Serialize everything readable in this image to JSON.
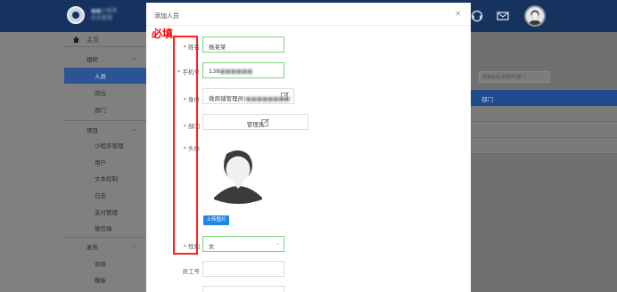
{
  "app": {
    "brand_line1": "■■小程序",
    "brand_line2": "后台管理"
  },
  "sidebar": {
    "home": "主页",
    "groups": [
      {
        "label": "组织",
        "items": [
          "人员",
          "岗位",
          "部门"
        ],
        "active": "人员"
      },
      {
        "label": "项目",
        "items": [
          "小程序管理",
          "用户",
          "文本控制",
          "日志",
          "支付管理",
          "微信端"
        ]
      },
      {
        "label": "发布",
        "items": [
          "审核",
          "模板"
        ]
      }
    ]
  },
  "background": {
    "search_placeholder": "搜索姓名/手机号/部门",
    "table_header": "部门"
  },
  "modal": {
    "title": "添加人员",
    "close": "×",
    "required_note": "必填",
    "fields": {
      "name_label": "姓名",
      "name_value": "杨某某",
      "phone_label": "手机号",
      "phone_value": "138",
      "phone_masked": "■■■■■■",
      "role_label": "身份",
      "role_value": "微商铺管理员(",
      "role_masked": "■■■■■■■■)",
      "dept_label": "部门",
      "dept_value": "管理员",
      "avatar_label": "头像",
      "upload_button": "上传图片",
      "gender_label": "性别",
      "gender_value": "女",
      "employee_no_label": "员工号",
      "employee_no_value": ""
    }
  },
  "colors": {
    "topbar": "#16325e",
    "accent": "#1e88e5",
    "required_red": "#ff0000",
    "valid_green": "#7ed07e"
  }
}
